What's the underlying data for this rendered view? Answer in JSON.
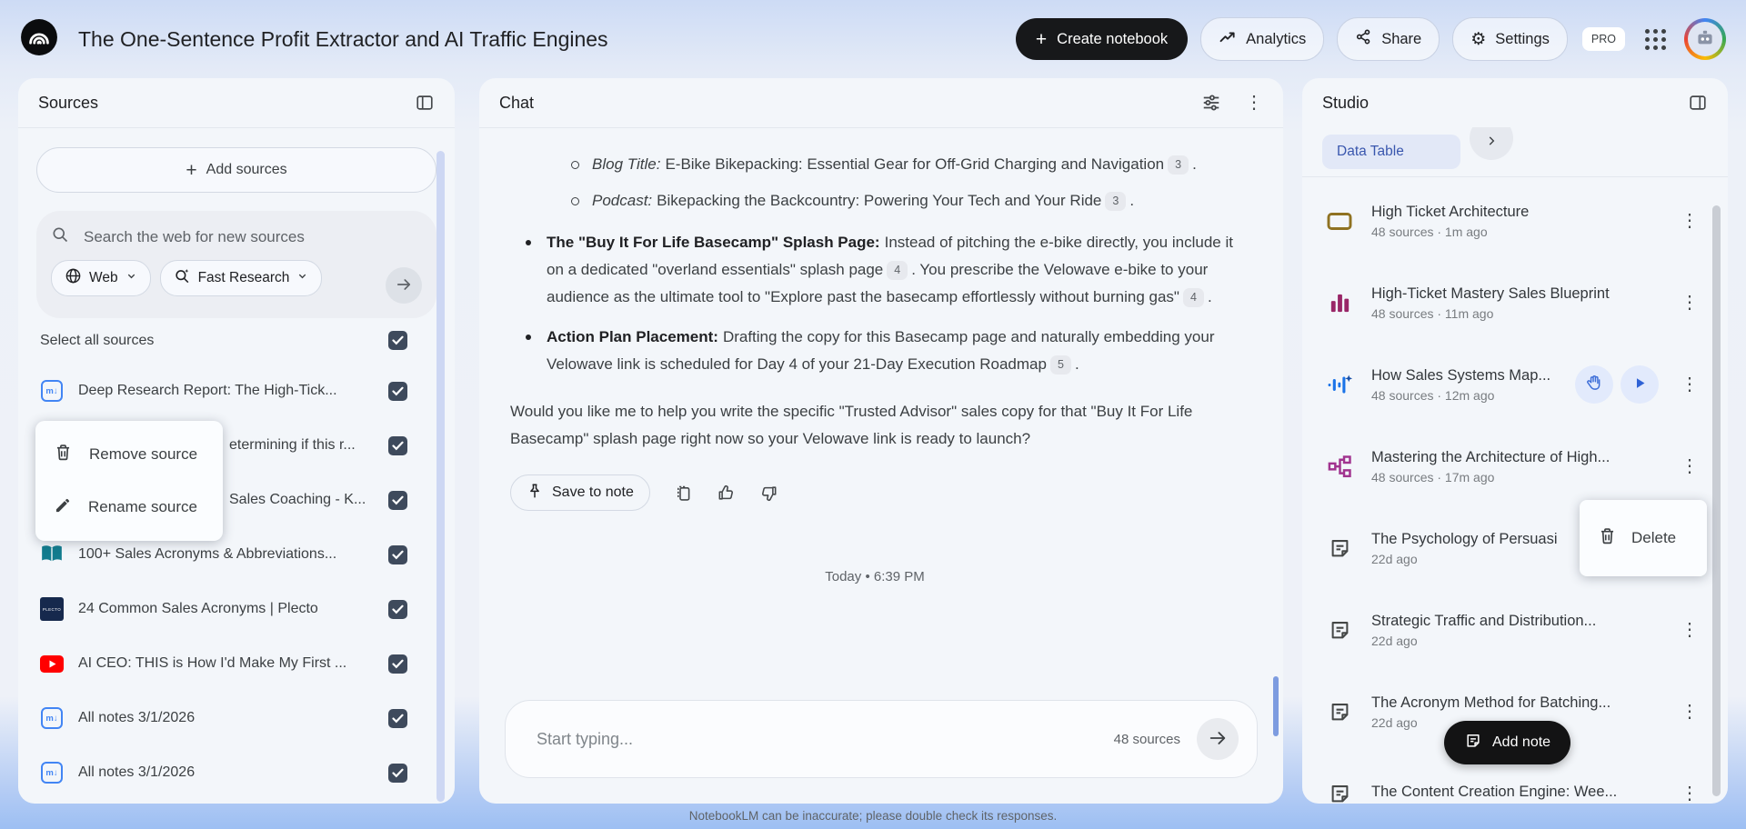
{
  "header": {
    "title": "The One-Sentence Profit Extractor and AI Traffic Engines",
    "create_notebook": "Create notebook",
    "analytics": "Analytics",
    "share": "Share",
    "settings": "Settings",
    "pro": "PRO"
  },
  "sources": {
    "title": "Sources",
    "add_sources": "Add sources",
    "search_placeholder": "Search the web for new sources",
    "web_chip": "Web",
    "research_chip": "Fast Research",
    "select_all": "Select all sources",
    "md_icon_text": "m↓",
    "plecto_icon_text": "PLECTO",
    "items": [
      {
        "title": "Deep Research Report: The High-Tick..."
      },
      {
        "title": "etermining if this r..."
      },
      {
        "title": "Sales Coaching - K..."
      },
      {
        "title": "100+ Sales Acronyms & Abbreviations..."
      },
      {
        "title": "24 Common Sales Acronyms | Plecto"
      },
      {
        "title": "AI CEO: THIS is How I'd Make My First ..."
      },
      {
        "title": "All notes 3/1/2026"
      },
      {
        "title": "All notes 3/1/2026"
      }
    ],
    "menu": {
      "remove": "Remove source",
      "rename": "Rename source"
    }
  },
  "chat": {
    "title": "Chat",
    "sub_bullets": [
      {
        "label": "Blog Title:",
        "text": "E-Bike Bikepacking: Essential Gear for Off-Grid Charging and Navigation",
        "cite": "3",
        "tail": "."
      },
      {
        "label": "Podcast:",
        "text": "Bikepacking the Backcountry: Powering Your Tech and Your Ride",
        "cite": "3",
        "tail": "."
      }
    ],
    "bullet1": {
      "label": "The \"Buy It For Life Basecamp\" Splash Page:",
      "seg1": "Instead of pitching the e-bike directly, you include it on a dedicated \"overland essentials\" splash page",
      "cite1": "4",
      "seg2": ". You prescribe the Velowave e-bike to your audience as the ultimate tool to \"Explore past the basecamp effortlessly without burning gas\"",
      "cite2": "4",
      "tail": "."
    },
    "bullet2": {
      "label": "Action Plan Placement:",
      "seg1": "Drafting the copy for this Basecamp page and naturally embedding your Velowave link is scheduled for Day 4 of your 21-Day Execution Roadmap",
      "cite1": "5",
      "tail": "."
    },
    "closing": "Would you like me to help you write the specific \"Trusted Advisor\" sales copy for that \"Buy It For Life Basecamp\" splash page right now so your Velowave link is ready to launch?",
    "save_to_note": "Save to note",
    "timestamp": "Today • 6:39 PM",
    "input_placeholder": "Start typing...",
    "source_count": "48 sources",
    "disclaimer": "NotebookLM can be inaccurate; please double check its responses."
  },
  "studio": {
    "title": "Studio",
    "chip": "Data Table",
    "items": [
      {
        "title": "High Ticket Architecture",
        "meta": "48 sources · 1m ago"
      },
      {
        "title": "High-Ticket Mastery Sales Blueprint",
        "meta": "48 sources · 11m ago"
      },
      {
        "title": "How Sales Systems Map...",
        "meta": "48 sources · 12m ago"
      },
      {
        "title": "Mastering the Architecture of High...",
        "meta": "48 sources · 17m ago"
      },
      {
        "title": "The Psychology of Persuasi",
        "meta": "22d ago"
      },
      {
        "title": "Strategic Traffic and Distribution...",
        "meta": "22d ago"
      },
      {
        "title": "The Acronym Method for Batching...",
        "meta": "22d ago"
      },
      {
        "title": "The Content Creation Engine: Wee...",
        "meta": ""
      }
    ],
    "delete": "Delete",
    "add_note": "Add note"
  }
}
